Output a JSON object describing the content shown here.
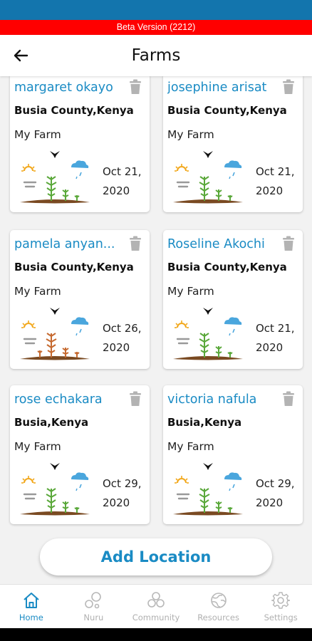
{
  "beta_banner": "Beta Version (2212)",
  "header": {
    "title": "Farms",
    "back_icon": "arrow-left-icon"
  },
  "farms": [
    {
      "name": "margaret okayo",
      "location": "Busia County,Kenya",
      "farm_name": "My Farm",
      "date_line1": "Oct 21,",
      "date_line2": "2020",
      "plant_style": "green"
    },
    {
      "name": "josephine arisat",
      "location": "Busia County,Kenya",
      "farm_name": "My Farm",
      "date_line1": "Oct 21,",
      "date_line2": "2020",
      "plant_style": "green"
    },
    {
      "name": "pamela anyan...",
      "location": "Busia County,Kenya",
      "farm_name": "My Farm",
      "date_line1": "Oct 26,",
      "date_line2": "2020",
      "plant_style": "brown"
    },
    {
      "name": "Roseline Akochi",
      "location": "Busia County,Kenya",
      "farm_name": "My Farm",
      "date_line1": "Oct 21,",
      "date_line2": "2020",
      "plant_style": "green"
    },
    {
      "name": "rose echakara",
      "location": "Busia,Kenya",
      "farm_name": "My Farm",
      "date_line1": "Oct 29,",
      "date_line2": "2020",
      "plant_style": "green"
    },
    {
      "name": "victoria nafula",
      "location": "Busia,Kenya",
      "farm_name": "My Farm",
      "date_line1": "Oct 29,",
      "date_line2": "2020",
      "plant_style": "green"
    }
  ],
  "add_location_label": "Add Location",
  "bottom_nav": [
    {
      "label": "Home",
      "icon": "home-icon",
      "active": true
    },
    {
      "label": "Nuru",
      "icon": "nuru-icon",
      "active": false
    },
    {
      "label": "Community",
      "icon": "community-icon",
      "active": false
    },
    {
      "label": "Resources",
      "icon": "globe-icon",
      "active": false
    },
    {
      "label": "Settings",
      "icon": "gear-icon",
      "active": false
    }
  ],
  "colors": {
    "accent": "#1a8bc4",
    "status_bar": "#1375ad",
    "beta_banner": "#ff0000",
    "inactive": "#b0b0b0"
  }
}
